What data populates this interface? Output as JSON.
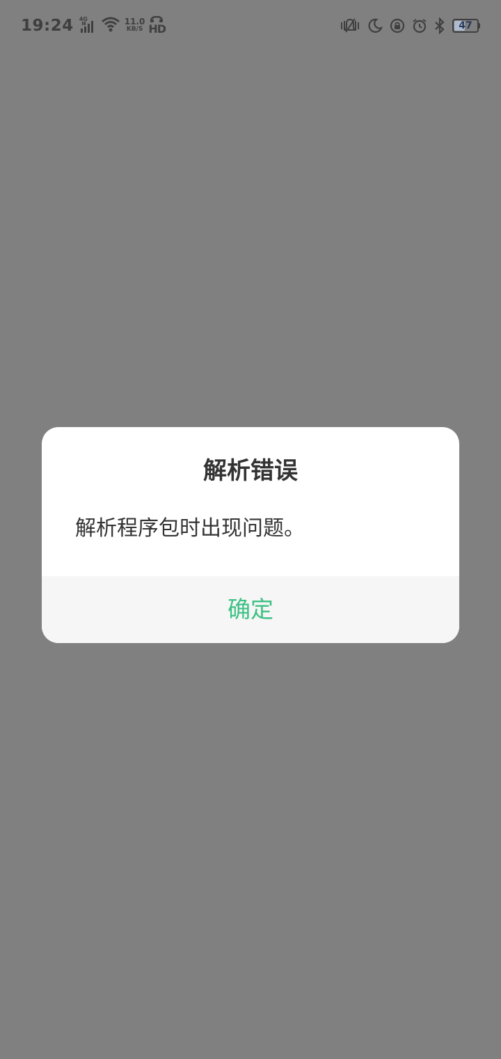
{
  "status_bar": {
    "time": "19:24",
    "network_type": "4G",
    "net_speed_value": "11.0",
    "net_speed_unit": "KB/S",
    "hd_label": "HD",
    "battery_level": "47",
    "battery_fraction": 0.47,
    "icons": [
      "signal-icon",
      "wifi-icon",
      "hd-call-icon",
      "vibrate-icon",
      "moon-icon",
      "rotation-lock-icon",
      "alarm-icon",
      "bluetooth-icon",
      "battery-icon"
    ],
    "colors": {
      "text": "#3f3f3f",
      "battery_fill": "#aebcd0"
    }
  },
  "dialog": {
    "title": "解析错误",
    "message": "解析程序包时出现问题。",
    "confirm_label": "确定",
    "colors": {
      "accent": "#3cc184",
      "background": "#ffffff",
      "button_area": "#f6f6f6",
      "scrim": "#808080"
    }
  }
}
